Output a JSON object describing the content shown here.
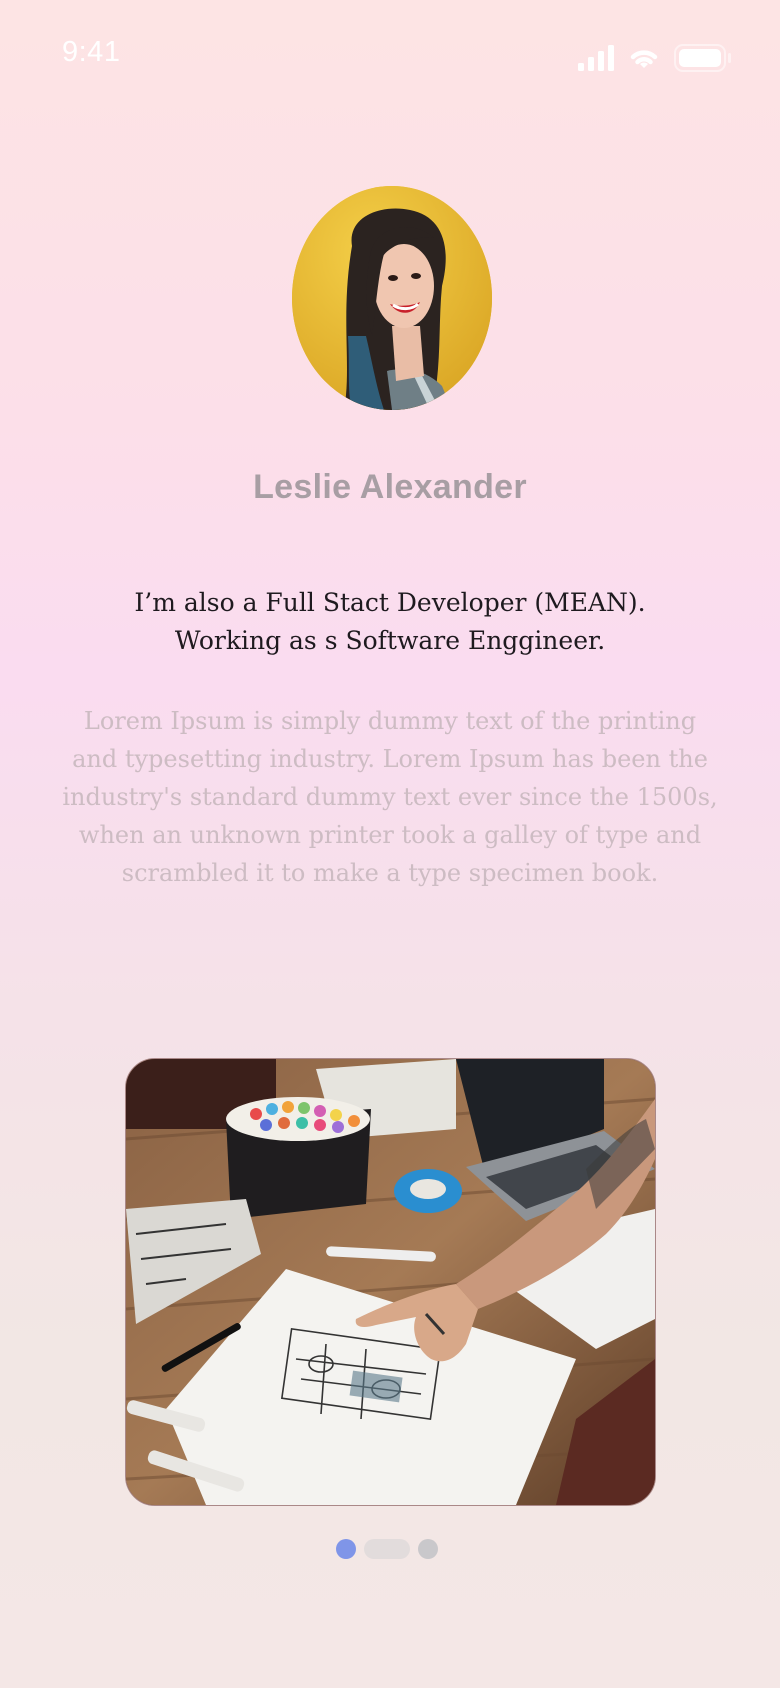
{
  "status_bar": {
    "time": "9:41",
    "icons": [
      "cellular-signal-icon",
      "wifi-icon",
      "battery-icon"
    ]
  },
  "profile": {
    "avatar": "profile-photo-woman",
    "name": "Leslie Alexander",
    "headline_line1": "I’m also a Full Stact Developer (MEAN).",
    "headline_line2": "Working as s Software Enggineer.",
    "bio": "Lorem Ipsum is simply dummy text of the printing  and typesetting industry. Lorem Ipsum has been the industry's standard dummy text ever since the 1500s, when an unknown printer took a galley of type and scrambled it to make a type specimen book."
  },
  "carousel": {
    "image": "workspace-sketch-photo",
    "page_count": 3,
    "current_page": 1
  },
  "colors": {
    "name_text": "#a89ea4",
    "headline_text": "#1e1a1f",
    "bio_text": "#cdbcc3",
    "dot_active": "#7f95e8",
    "dot_inactive": "#c9c8cb"
  }
}
